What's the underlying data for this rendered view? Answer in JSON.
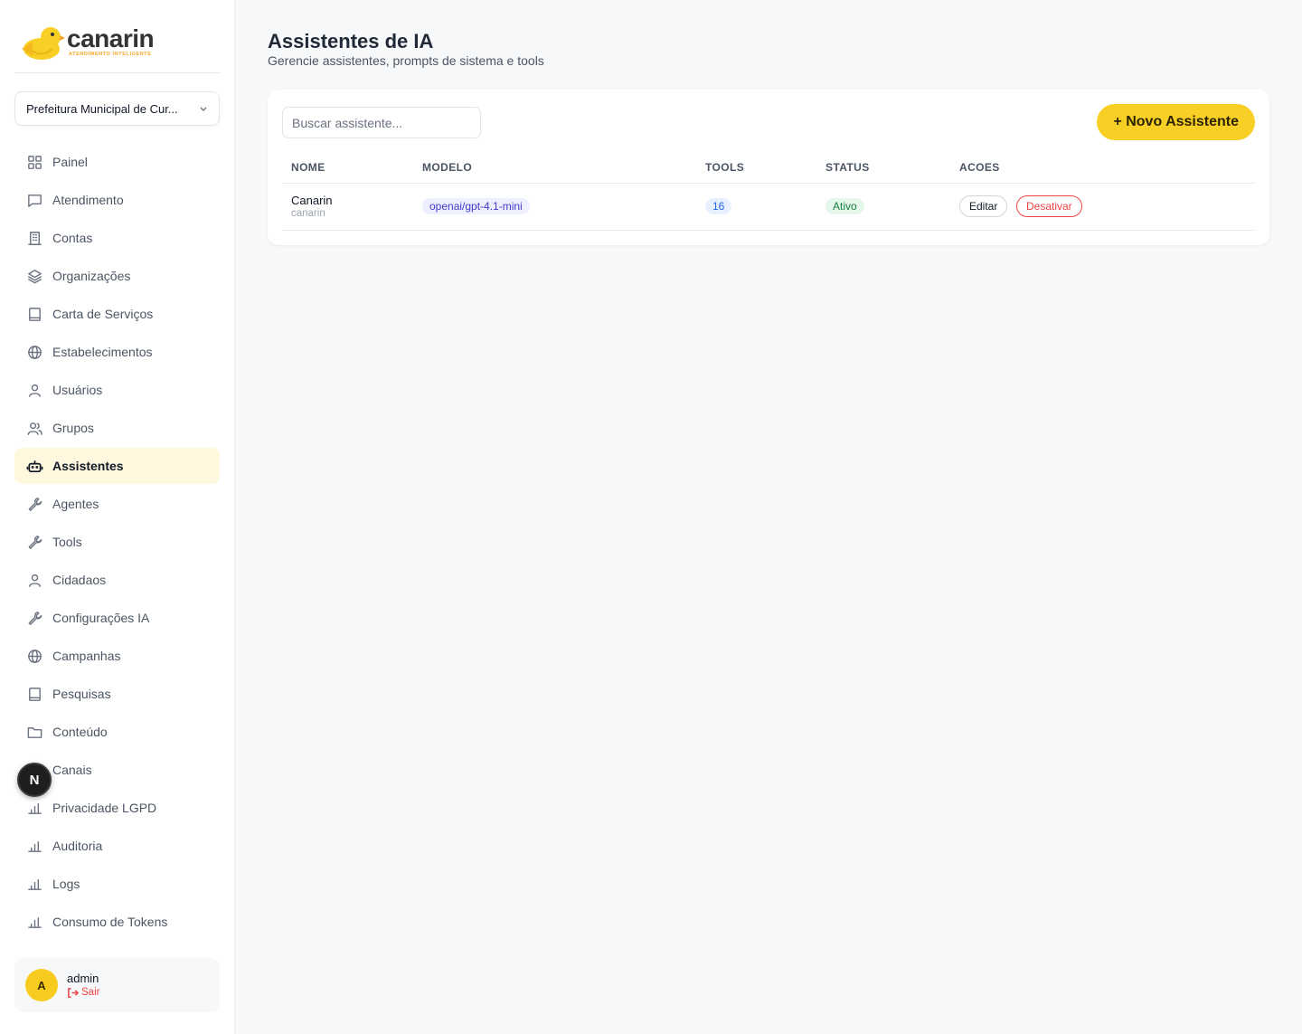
{
  "brand": {
    "name": "canarin",
    "tagline": "ATENDIMENTO INTELIGENTE",
    "accent": "#F8CF25",
    "tagline_color": "#F5A524"
  },
  "org_selector": {
    "value": "Prefeitura Municipal de Cur..."
  },
  "sidebar": {
    "items": [
      {
        "label": "Painel",
        "icon": "grid-icon",
        "active": false
      },
      {
        "label": "Atendimento",
        "icon": "chat-icon",
        "active": false
      },
      {
        "label": "Contas",
        "icon": "building-icon",
        "active": false
      },
      {
        "label": "Organizações",
        "icon": "layers-icon",
        "active": false
      },
      {
        "label": "Carta de Serviços",
        "icon": "book-icon",
        "active": false
      },
      {
        "label": "Estabelecimentos",
        "icon": "globe-icon",
        "active": false
      },
      {
        "label": "Usuários",
        "icon": "user-icon",
        "active": false
      },
      {
        "label": "Grupos",
        "icon": "users-icon",
        "active": false
      },
      {
        "label": "Assistentes",
        "icon": "bot-icon",
        "active": true
      },
      {
        "label": "Agentes",
        "icon": "wrench-icon",
        "active": false
      },
      {
        "label": "Tools",
        "icon": "wrench-icon",
        "active": false
      },
      {
        "label": "Cidadaos",
        "icon": "user-icon",
        "active": false
      },
      {
        "label": "Configurações IA",
        "icon": "wrench-icon",
        "active": false
      },
      {
        "label": "Campanhas",
        "icon": "globe-icon",
        "active": false
      },
      {
        "label": "Pesquisas",
        "icon": "book-icon",
        "active": false
      },
      {
        "label": "Conteúdo",
        "icon": "folder-icon",
        "active": false
      },
      {
        "label": "Canais",
        "icon": "chart-icon",
        "active": false
      },
      {
        "label": "Privacidade LGPD",
        "icon": "chart-icon",
        "active": false
      },
      {
        "label": "Auditoria",
        "icon": "chart-icon",
        "active": false
      },
      {
        "label": "Logs",
        "icon": "chart-icon",
        "active": false
      },
      {
        "label": "Consumo de Tokens",
        "icon": "chart-icon",
        "active": false
      }
    ]
  },
  "dev_badge": {
    "letter": "N"
  },
  "user": {
    "initial": "A",
    "name": "admin",
    "logout_label": "Sair"
  },
  "page": {
    "title": "Assistentes de IA",
    "subtitle": "Gerencie assistentes, prompts de sistema e tools"
  },
  "toolbar": {
    "search_placeholder": "Buscar assistente...",
    "new_button_label": "+ Novo Assistente"
  },
  "table": {
    "columns": [
      "NOME",
      "MODELO",
      "TOOLS",
      "STATUS",
      "ACOES"
    ],
    "rows": [
      {
        "name": "Canarin",
        "slug": "canarin",
        "model": "openai/gpt-4.1-mini",
        "tools": "16",
        "status": "Ativo",
        "edit_label": "Editar",
        "disable_label": "Desativar"
      }
    ]
  }
}
